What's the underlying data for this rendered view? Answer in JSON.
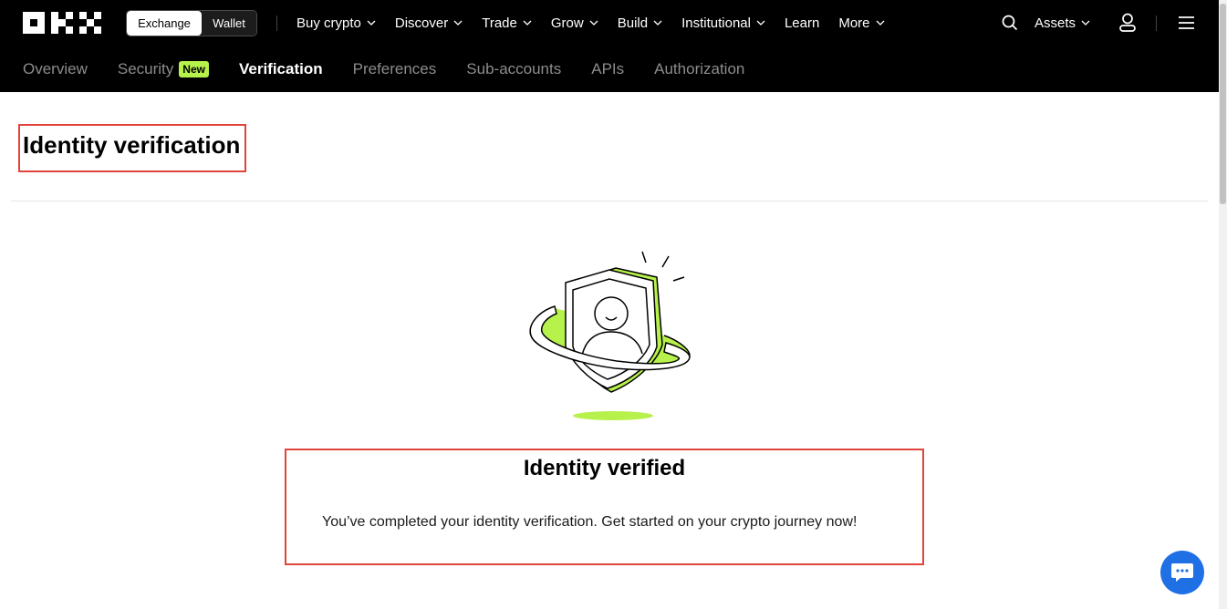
{
  "header": {
    "logo_name": "OKX",
    "toggle": {
      "exchange_label": "Exchange",
      "wallet_label": "Wallet"
    },
    "menu": [
      {
        "label": "Buy crypto",
        "has_dropdown": true
      },
      {
        "label": "Discover",
        "has_dropdown": true
      },
      {
        "label": "Trade",
        "has_dropdown": true
      },
      {
        "label": "Grow",
        "has_dropdown": true
      },
      {
        "label": "Build",
        "has_dropdown": true
      },
      {
        "label": "Institutional",
        "has_dropdown": true
      },
      {
        "label": "Learn",
        "has_dropdown": false
      },
      {
        "label": "More",
        "has_dropdown": true
      }
    ],
    "assets_label": "Assets",
    "icons": [
      "search-icon",
      "user-icon",
      "hamburger-menu-icon"
    ]
  },
  "subnav": {
    "items": [
      {
        "label": "Overview",
        "active": false
      },
      {
        "label": "Security",
        "active": false,
        "badge": "New"
      },
      {
        "label": "Verification",
        "active": true
      },
      {
        "label": "Preferences",
        "active": false
      },
      {
        "label": "Sub-accounts",
        "active": false
      },
      {
        "label": "APIs",
        "active": false
      },
      {
        "label": "Authorization",
        "active": false
      }
    ]
  },
  "main": {
    "title": "Identity verification",
    "status_title": "Identity verified",
    "status_description": "You’ve completed your identity verification. Get started on your crypto journey now!"
  },
  "colors": {
    "accent_green": "#b7f14b",
    "header_bg": "#000000",
    "highlight_red": "#e0443b",
    "chat_blue": "#1f6fe5"
  }
}
